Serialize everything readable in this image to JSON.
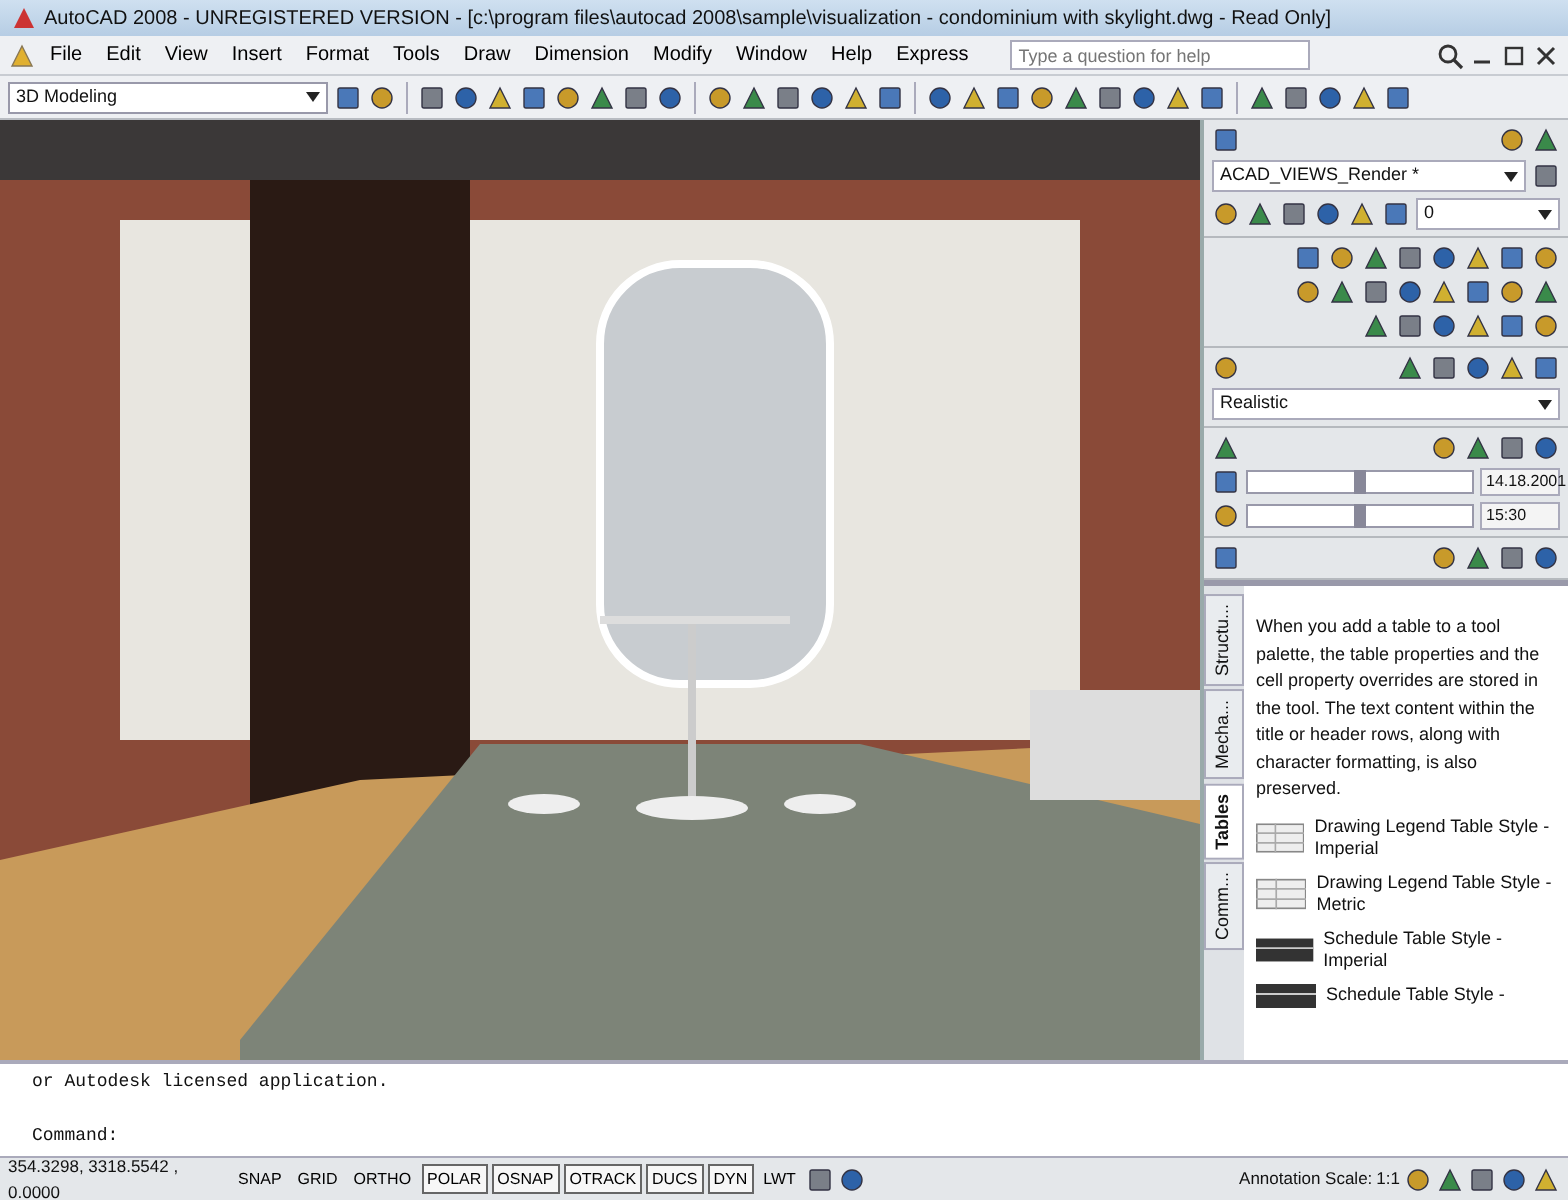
{
  "window": {
    "title": "AutoCAD 2008 - UNREGISTERED VERSION - [c:\\program files\\autocad 2008\\sample\\visualization - condominium with skylight.dwg - Read Only]"
  },
  "menu": [
    "File",
    "Edit",
    "View",
    "Insert",
    "Format",
    "Tools",
    "Draw",
    "Dimension",
    "Modify",
    "Window",
    "Help",
    "Express"
  ],
  "help_search": {
    "placeholder": "Type a question for help"
  },
  "toolbar": {
    "workspace": "3D Modeling"
  },
  "dashboard": {
    "view": "ACAD_VIEWS_Render *",
    "layer": "0",
    "visual_style": "Realistic",
    "sun_date": {
      "level": 0.5,
      "reading": "14.18.2001"
    },
    "sun_time": {
      "level": 0.5,
      "reading": "15:30"
    }
  },
  "palette": {
    "tabs": [
      {
        "label": "Structu...",
        "selected": false
      },
      {
        "label": "Mecha...",
        "selected": false
      },
      {
        "label": "Tables",
        "selected": true
      },
      {
        "label": "Comm...",
        "selected": false
      }
    ],
    "description": "When you add a table to a tool palette, the table properties and the cell property overrides are stored in the tool. The text content within the title or header rows, along with character formatting, is also preserved.",
    "items": [
      {
        "label": "Drawing Legend Table Style - Imperial",
        "kind": "legend"
      },
      {
        "label": "Drawing Legend Table Style - Metric",
        "kind": "legend"
      },
      {
        "label": "Schedule Table Style - Imperial",
        "kind": "schedule"
      },
      {
        "label": "Schedule Table Style -",
        "kind": "schedule"
      }
    ]
  },
  "command_line": {
    "history": [
      "or Autodesk licensed application."
    ],
    "prompt": "Command:"
  },
  "status_bar": {
    "coordinates": "354.3298, 3318.5542 , 0.0000",
    "toggles": [
      {
        "label": "SNAP",
        "on": false
      },
      {
        "label": "GRID",
        "on": false
      },
      {
        "label": "ORTHO",
        "on": false
      },
      {
        "label": "POLAR",
        "on": true
      },
      {
        "label": "OSNAP",
        "on": true
      },
      {
        "label": "OTRACK",
        "on": true
      },
      {
        "label": "DUCS",
        "on": true
      },
      {
        "label": "DYN",
        "on": true
      },
      {
        "label": "LWT",
        "on": false
      }
    ],
    "annotation_label": "Annotation Scale:",
    "annotation_scale": "1:1"
  }
}
